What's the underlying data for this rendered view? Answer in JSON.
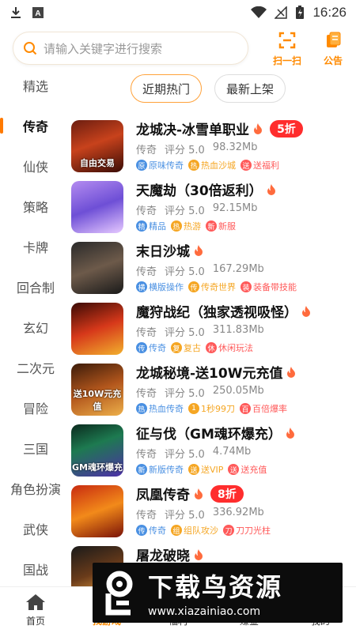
{
  "status": {
    "time": "16:26"
  },
  "search": {
    "placeholder": "请输入关键字进行搜索"
  },
  "top_actions": [
    {
      "label": "扫一扫",
      "icon": "scan-icon"
    },
    {
      "label": "公告",
      "icon": "notice-icon"
    }
  ],
  "sidebar": {
    "items": [
      "精选",
      "传奇",
      "仙侠",
      "策略",
      "卡牌",
      "回合制",
      "玄幻",
      "二次元",
      "冒险",
      "三国",
      "角色扮演",
      "武侠",
      "国战"
    ],
    "active_index": 1
  },
  "tabs": [
    {
      "label": "近期热门",
      "active": true
    },
    {
      "label": "最新上架",
      "active": false
    }
  ],
  "games": [
    {
      "title": "龙城决-冰雪单职业",
      "discount": "5折",
      "thumb_label": "自由交易",
      "category": "传奇",
      "rating": "评分 5.0",
      "size": "98.32Mb",
      "tags": [
        {
          "icon": "原",
          "text": "原味传奇",
          "color": "#4a90e2"
        },
        {
          "icon": "热",
          "text": "热血沙城",
          "color": "#f5a623"
        },
        {
          "icon": "送",
          "text": "送福利",
          "color": "#ff5a5a"
        }
      ]
    },
    {
      "title": "天魔劫（30倍返利）",
      "discount": "",
      "thumb_label": "",
      "category": "传奇",
      "rating": "评分 5.0",
      "size": "92.15Mb",
      "tags": [
        {
          "icon": "精",
          "text": "精品",
          "color": "#4a90e2"
        },
        {
          "icon": "热",
          "text": "热游",
          "color": "#f5a623"
        },
        {
          "icon": "新",
          "text": "新服",
          "color": "#ff5a5a"
        }
      ]
    },
    {
      "title": "末日沙城",
      "discount": "",
      "thumb_label": "",
      "category": "传奇",
      "rating": "评分 5.0",
      "size": "167.29Mb",
      "tags": [
        {
          "icon": "横",
          "text": "横版操作",
          "color": "#4a90e2"
        },
        {
          "icon": "传",
          "text": "传奇世界",
          "color": "#f5a623"
        },
        {
          "icon": "装",
          "text": "装备带技能",
          "color": "#ff5a5a"
        }
      ]
    },
    {
      "title": "魔狩战纪（独家透视吸怪）",
      "discount": "",
      "thumb_label": "",
      "category": "传奇",
      "rating": "评分 5.0",
      "size": "311.83Mb",
      "tags": [
        {
          "icon": "传",
          "text": "传奇",
          "color": "#4a90e2"
        },
        {
          "icon": "复",
          "text": "复古",
          "color": "#f5a623"
        },
        {
          "icon": "休",
          "text": "休闲玩法",
          "color": "#ff5a5a"
        }
      ]
    },
    {
      "title": "龙城秘境-送10W元充值",
      "discount": "",
      "thumb_label": "送10W元充值",
      "category": "传奇",
      "rating": "评分 5.0",
      "size": "250.05Mb",
      "tags": [
        {
          "icon": "热",
          "text": "热血传奇",
          "color": "#4a90e2"
        },
        {
          "icon": "1",
          "text": "1秒99刀",
          "color": "#f5a623"
        },
        {
          "icon": "百",
          "text": "百倍爆率",
          "color": "#ff5a5a"
        }
      ]
    },
    {
      "title": "征与伐（GM魂环爆充）",
      "discount": "",
      "thumb_label": "GM魂环爆充",
      "category": "传奇",
      "rating": "评分 5.0",
      "size": "4.74Mb",
      "tags": [
        {
          "icon": "新",
          "text": "新版传奇",
          "color": "#4a90e2"
        },
        {
          "icon": "送",
          "text": "送VIP",
          "color": "#f5a623"
        },
        {
          "icon": "送",
          "text": "送充值",
          "color": "#ff5a5a"
        }
      ]
    },
    {
      "title": "凤凰传奇",
      "discount": "8折",
      "thumb_label": "",
      "category": "传奇",
      "rating": "评分 5.0",
      "size": "336.92Mb",
      "tags": [
        {
          "icon": "传",
          "text": "传奇",
          "color": "#4a90e2"
        },
        {
          "icon": "组",
          "text": "组队攻沙",
          "color": "#f5a623"
        },
        {
          "icon": "刀",
          "text": "刀刀光柱",
          "color": "#ff5a5a"
        }
      ]
    },
    {
      "title": "屠龙破晓",
      "discount": "",
      "thumb_label": "",
      "category": "",
      "rating": "",
      "size": "",
      "tags": []
    }
  ],
  "bottom_nav": [
    {
      "label": "首页",
      "icon": "home-icon",
      "active": false
    },
    {
      "label": "找游戏",
      "icon": "find-game-icon",
      "active": true
    },
    {
      "label": "福利",
      "icon": "gift-icon",
      "active": false
    },
    {
      "label": "赚金",
      "icon": "coin-icon",
      "active": false
    },
    {
      "label": "我的",
      "icon": "user-icon",
      "active": false
    }
  ],
  "watermark": {
    "title": "下载鸟资源",
    "url": "www.xiazainiao.com"
  },
  "colors": {
    "accent": "#ff8a00",
    "discount": "#ff2d2d",
    "tab_border": "#ffa23a"
  }
}
